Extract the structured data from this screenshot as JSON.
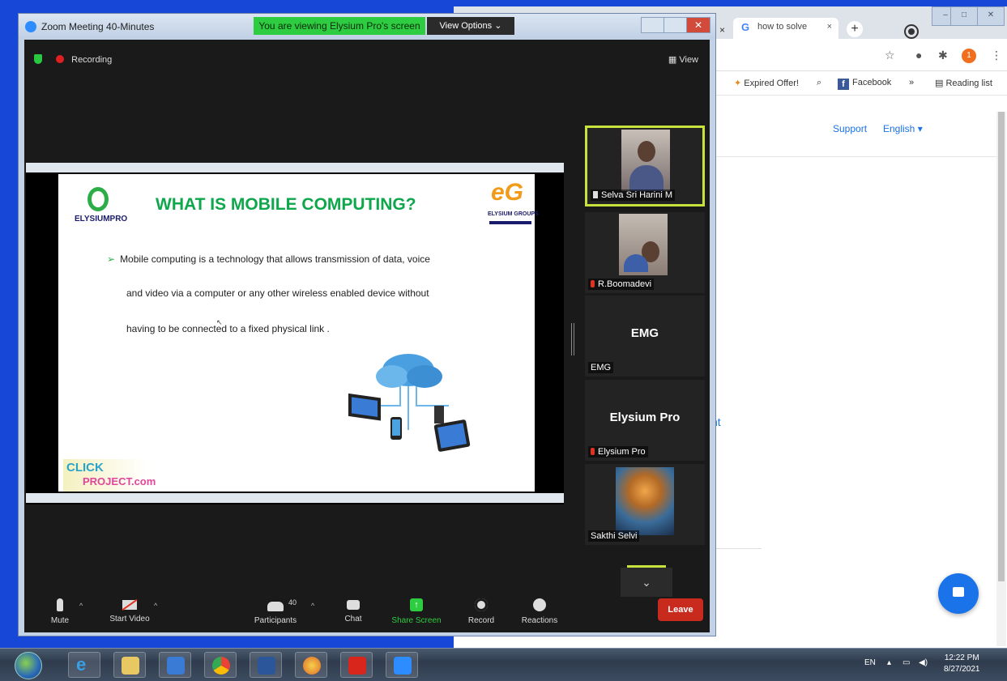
{
  "chrome": {
    "tab_label": "how to solve",
    "tab_favicon": "G",
    "tab_close": "×",
    "left_tab_close": "×",
    "new_tab": "+",
    "min": "–",
    "max": "□",
    "close": "✕",
    "bookmarks": {
      "expired": "Expired Offer!",
      "facebook": "Facebook",
      "more": "»",
      "reading_list": "Reading list"
    },
    "page": {
      "support": "Support",
      "english": "English ▾",
      "partial": "nt"
    },
    "ext_badge": "1"
  },
  "zoom": {
    "window_title": "Zoom Meeting 40-Minutes",
    "viewing_banner": "You are viewing Elysium Pro's screen",
    "view_options": "View Options ⌄",
    "recording": "Recording",
    "view_button": "▦ View",
    "slide": {
      "title": "WHAT IS MOBILE COMPUTING?",
      "logo_left": "ELYSIUMPRO",
      "logo_right_letters": "eG",
      "logo_right": "ELYSIUM GROUPS",
      "bullet": "➢",
      "line1": "Mobile computing is a technology that allows  transmission of data, voice",
      "line2": "and video via a  computer or any other wireless enabled device  without",
      "line3": "having to be connected to a fixed  physical link .",
      "click_top": "CLICK",
      "click_bottom": "PROJECT.com"
    },
    "participants": [
      {
        "name": "Selva Sri Harini M",
        "active": true
      },
      {
        "name": "R.Boomadevi"
      },
      {
        "name": "EMG",
        "big": "EMG"
      },
      {
        "name": "Elysium Pro",
        "big": "Elysium Pro"
      },
      {
        "name": "Sakthi Selvi"
      }
    ],
    "scroll_down": "⌄",
    "toolbar": {
      "mute": "Mute",
      "start_video": "Start Video",
      "participants": "Participants",
      "participant_count": "40",
      "chat": "Chat",
      "share_screen": "Share Screen",
      "share_icon": "↑",
      "record": "Record",
      "reactions": "Reactions",
      "leave": "Leave",
      "caret": "^"
    }
  },
  "taskbar": {
    "lang": "EN",
    "tray_arrow": "▴",
    "time": "12:22 PM",
    "date": "8/27/2021"
  },
  "colors": {
    "zoom_green": "#2ecc40",
    "leave_red": "#c92a1e",
    "slide_title_green": "#0fa74b",
    "active_speaker": "#c7e23c",
    "desktop_blue": "#1747d6"
  }
}
